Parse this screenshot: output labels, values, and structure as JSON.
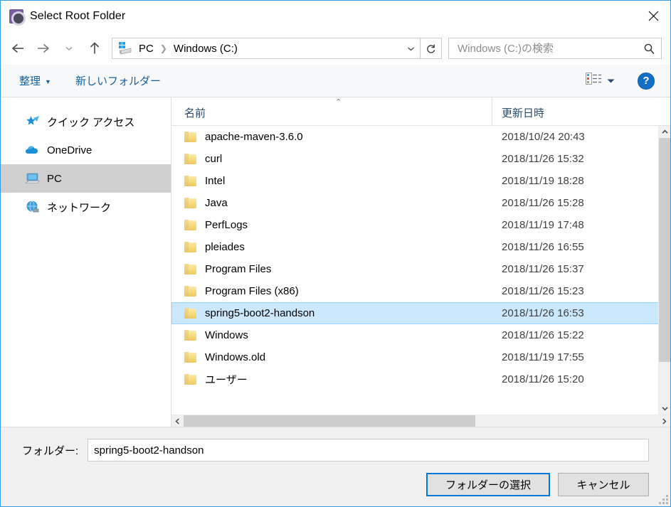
{
  "window": {
    "title": "Select Root Folder",
    "app_icon": "gear-purple-icon",
    "close_label": "✕"
  },
  "nav": {
    "back": "←",
    "forward": "→",
    "recent": "⌄",
    "up": "↑",
    "refresh": "↻",
    "dropdown": "⌄"
  },
  "address": {
    "drive_icon": "windows-drive-icon",
    "crumbs": [
      "PC",
      "Windows (C:)"
    ],
    "separator": "❯"
  },
  "search": {
    "placeholder": "Windows (C:)の検索",
    "value": "",
    "icon": "search-icon"
  },
  "toolbar": {
    "organize": "整理",
    "organize_caret": "▼",
    "new_folder": "新しいフォルダー",
    "view_caret": "▼",
    "help": "?"
  },
  "sidebar": {
    "items": [
      {
        "label": "クイック アクセス",
        "icon": "star-pin-icon",
        "selected": false
      },
      {
        "label": "OneDrive",
        "icon": "cloud-icon",
        "selected": false
      },
      {
        "label": "PC",
        "icon": "computer-icon",
        "selected": true
      },
      {
        "label": "ネットワーク",
        "icon": "network-globe-icon",
        "selected": false
      }
    ]
  },
  "filelist": {
    "columns": [
      "名前",
      "更新日時"
    ],
    "sort_indicator": "⌃",
    "rows": [
      {
        "name": "apache-maven-3.6.0",
        "date": "2018/10/24 20:43",
        "selected": false
      },
      {
        "name": "curl",
        "date": "2018/11/26 15:32",
        "selected": false
      },
      {
        "name": "Intel",
        "date": "2018/11/19 18:28",
        "selected": false
      },
      {
        "name": "Java",
        "date": "2018/11/26 15:28",
        "selected": false
      },
      {
        "name": "PerfLogs",
        "date": "2018/11/19 17:48",
        "selected": false
      },
      {
        "name": "pleiades",
        "date": "2018/11/26 16:55",
        "selected": false
      },
      {
        "name": "Program Files",
        "date": "2018/11/26 15:37",
        "selected": false
      },
      {
        "name": "Program Files (x86)",
        "date": "2018/11/26 15:23",
        "selected": false
      },
      {
        "name": "spring5-boot2-handson",
        "date": "2018/11/26 16:53",
        "selected": true
      },
      {
        "name": "Windows",
        "date": "2018/11/26 15:22",
        "selected": false
      },
      {
        "name": "Windows.old",
        "date": "2018/11/19 17:55",
        "selected": false
      },
      {
        "name": "ユーザー",
        "date": "2018/11/26 15:20",
        "selected": false
      }
    ]
  },
  "scrollbars": {
    "v_up": "⌃",
    "v_down": "⌄",
    "h_left": "‹",
    "h_right": "›"
  },
  "footer": {
    "folder_label": "フォルダー:",
    "folder_value": "spring5-boot2-handson",
    "select_button": "フォルダーの選択",
    "cancel_button": "キャンセル"
  },
  "colors": {
    "accent": "#0078d7",
    "selection": "#cce8ff",
    "window_border": "#3c9ae0",
    "link": "#17609e"
  }
}
